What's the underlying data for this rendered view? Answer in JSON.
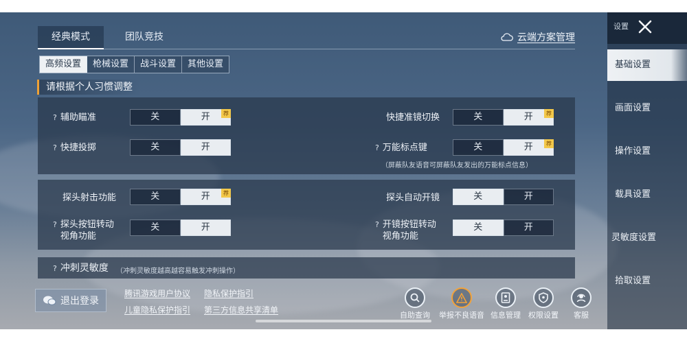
{
  "header": {
    "mode_tabs": [
      "经典模式",
      "团队竞技"
    ],
    "cloud_label": "云端方案管理"
  },
  "sub_tabs": [
    "高频设置",
    "枪械设置",
    "战斗设置",
    "其他设置"
  ],
  "hint": "请根据个人习惯调整",
  "toggle_labels": {
    "off": "关",
    "on": "开",
    "recommend": "荐"
  },
  "panel1": {
    "aim_assist": "辅助瞄准",
    "scope_switch": "快捷准镜切换",
    "quick_throw": "快捷投掷",
    "marker_key": "万能标点键",
    "marker_note": "（屏蔽队友语音可屏蔽队友发出的万能标点信息）"
  },
  "panel2": {
    "peek_fire": "探头射击功能",
    "peek_auto_scope": "探头自动开镜",
    "peek_btn_rotate": "探头按钮转动视角功能",
    "scope_btn_rotate": "开镜按钮转动视角功能"
  },
  "panel3": {
    "sprint_sens": "冲刺灵敏度",
    "sprint_note": "（冲刺灵敏度越高越容易触发冲刺操作）"
  },
  "sidebar": {
    "title": "设置",
    "items": [
      "基础设置",
      "画面设置",
      "操作设置",
      "载具设置",
      "灵敏度设置",
      "拾取设置"
    ]
  },
  "footer": {
    "logout": "退出登录",
    "links": [
      "腾讯游戏用户协议",
      "隐私保护指引",
      "儿童隐私保护指引",
      "第三方信息共享清单"
    ],
    "tools": [
      "自助查询",
      "举报不良语音",
      "信息管理",
      "权限设置",
      "客服"
    ]
  },
  "colors": {
    "accent": "#f0a235",
    "recommend": "#f3c84a",
    "selected": "#e9edf1"
  }
}
